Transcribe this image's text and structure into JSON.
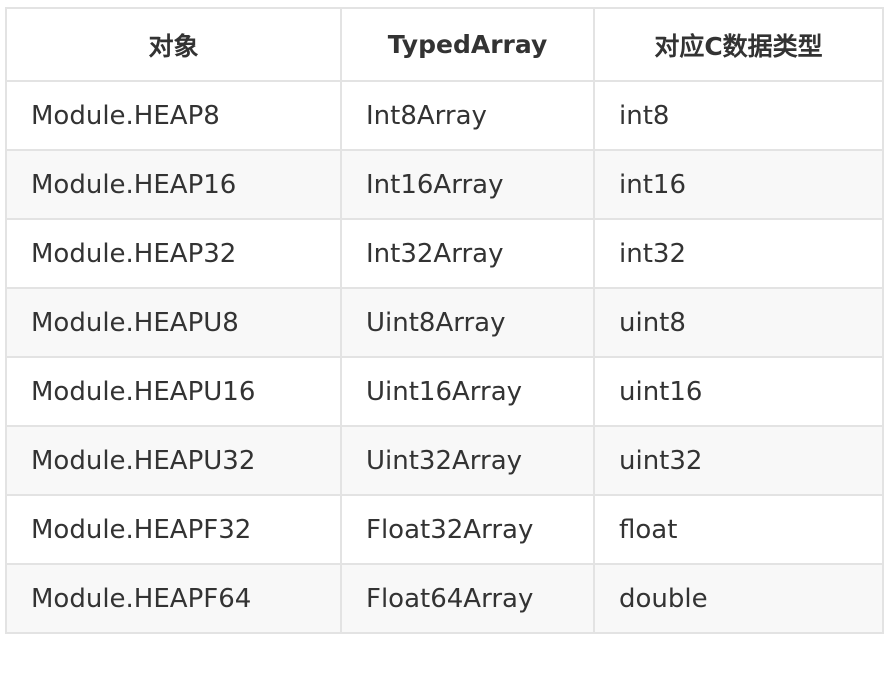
{
  "table": {
    "headers": [
      "对象",
      "TypedArray",
      "对应C数据类型"
    ],
    "rows": [
      [
        "Module.HEAP8",
        "Int8Array",
        "int8"
      ],
      [
        "Module.HEAP16",
        "Int16Array",
        "int16"
      ],
      [
        "Module.HEAP32",
        "Int32Array",
        "int32"
      ],
      [
        "Module.HEAPU8",
        "Uint8Array",
        "uint8"
      ],
      [
        "Module.HEAPU16",
        "Uint16Array",
        "uint16"
      ],
      [
        "Module.HEAPU32",
        "Uint32Array",
        "uint32"
      ],
      [
        "Module.HEAPF32",
        "Float32Array",
        "float"
      ],
      [
        "Module.HEAPF64",
        "Float64Array",
        "double"
      ]
    ]
  }
}
